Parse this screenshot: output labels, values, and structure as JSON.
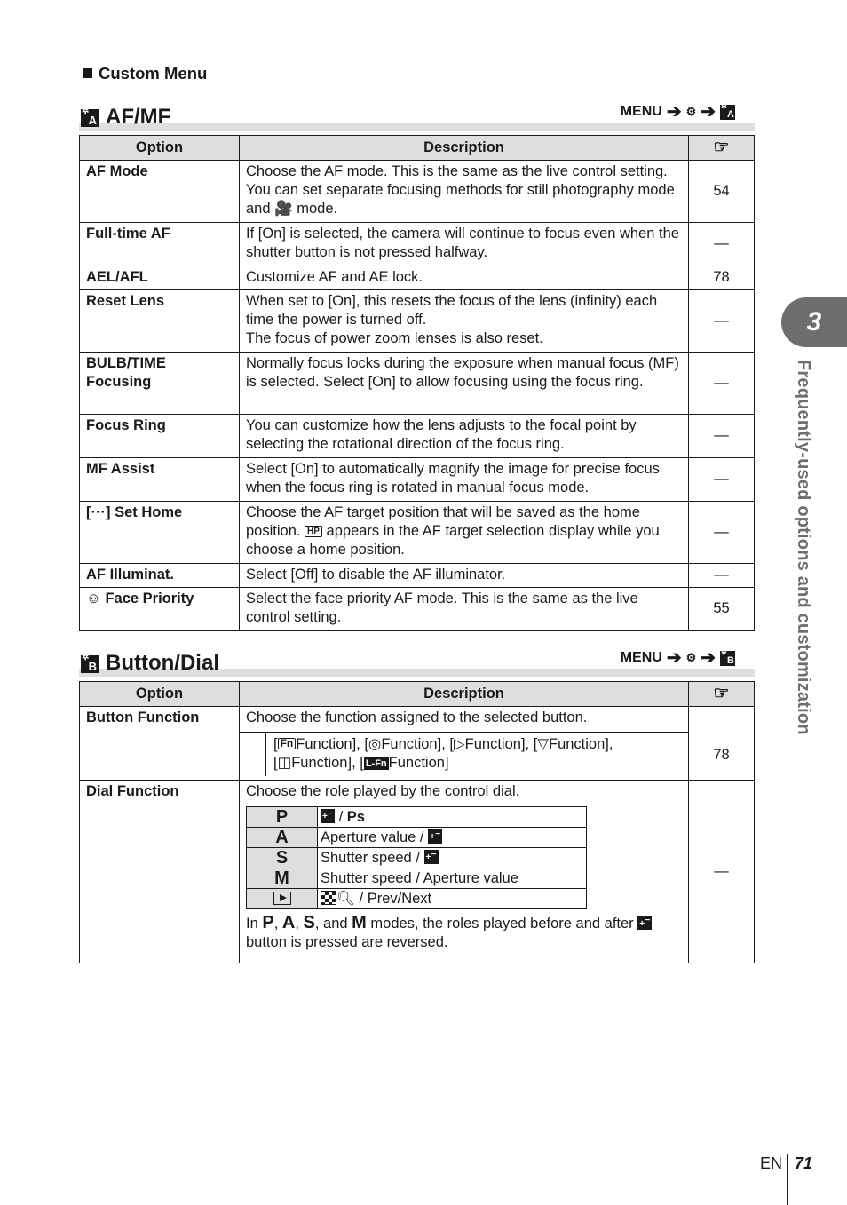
{
  "page": {
    "heading": "Custom Menu",
    "side_tab": {
      "chapter": "3",
      "label": "Frequently-used options and customization"
    },
    "footer": {
      "lang": "EN",
      "page_number": "71"
    }
  },
  "table_headers": {
    "option": "Option",
    "description": "Description",
    "ref_icon": "page-reference-hand-icon"
  },
  "afmf": {
    "title": "AF/MF",
    "icon_letter": "A",
    "menu_path": {
      "menu": "MENU",
      "icon1": "custom-menu-gear-icon",
      "icon2": "custom-menu-A-icon"
    },
    "rows": [
      {
        "option": "AF Mode",
        "desc_a": "Choose the AF mode. This is the same as the live control setting. You can set separate focusing methods for still photography mode and ",
        "desc_icon": "movie-camera-icon",
        "desc_b": " mode.",
        "ref": "54"
      },
      {
        "option": "Full-time AF",
        "desc": "If [On] is selected, the camera will continue to focus even when the shutter button is not pressed halfway.",
        "ref": "—"
      },
      {
        "option": "AEL/AFL",
        "desc": "Customize AF and AE lock.",
        "ref": "78"
      },
      {
        "option": "Reset Lens",
        "desc": "When set to [On], this resets the focus of the lens (infinity) each time the power is turned off.",
        "desc2": "The focus of power zoom lenses is also reset.",
        "ref": "—"
      },
      {
        "option": "BULB/TIME Focusing",
        "desc": "Normally focus locks during the exposure when manual focus (MF) is selected. Select [On] to allow focusing using the focus ring.",
        "ref": "—"
      },
      {
        "option": "Focus Ring",
        "desc": "You can customize how the lens adjusts to the focal point by selecting the rotational direction of the focus ring.",
        "ref": "—"
      },
      {
        "option": "MF Assist",
        "desc": "Select [On] to automatically magnify the image for precise focus when the focus ring is rotated in manual focus mode.",
        "ref": "—"
      },
      {
        "option_icon": "[···]",
        "option": "Set Home",
        "desc_a": "Choose the AF target position that will be saved as the home position. ",
        "desc_icon": "HP",
        "desc_b": " appears in the AF target selection display while you choose a home position.",
        "ref": "—"
      },
      {
        "option": "AF Illuminat.",
        "desc": "Select [Off] to disable the AF illuminator.",
        "ref": "—"
      },
      {
        "option_icon": "☺",
        "option": "Face Priority",
        "desc": "Select the face priority AF mode. This is the same as the live control setting.",
        "ref": "55"
      }
    ]
  },
  "buttondial": {
    "title": "Button/Dial",
    "icon_letter": "B",
    "menu_path": {
      "menu": "MENU",
      "icon1": "custom-menu-gear-icon",
      "icon2": "custom-menu-B-icon"
    },
    "button_function": {
      "option": "Button Function",
      "desc": "Choose the function assigned to the selected button.",
      "functions": [
        {
          "icon": "Fn",
          "label": "Function"
        },
        {
          "icon": "◎",
          "label": "Function"
        },
        {
          "icon": "▷",
          "label": "Function"
        },
        {
          "icon": "▽",
          "label": "Function"
        },
        {
          "icon": "◫",
          "label": "Function"
        },
        {
          "icon": "L-Fn",
          "label": "Function"
        }
      ],
      "ref": "78"
    },
    "dial_function": {
      "option": "Dial Function",
      "desc": "Choose the role played by the control dial.",
      "modes": [
        {
          "mode": "P",
          "role_icon": "exposure-compensation-icon",
          "role": " / ",
          "role_bold": "Ps"
        },
        {
          "mode": "A",
          "role": "Aperture value  / ",
          "role_icon_after": "exposure-compensation-icon"
        },
        {
          "mode": "S",
          "role": "Shutter speed  / ",
          "role_icon_after": "exposure-compensation-icon"
        },
        {
          "mode": "M",
          "role": "Shutter speed  / Aperture value"
        },
        {
          "mode_icon": "playback-icon",
          "role_icon": "index-magnify-icon",
          "role": "  / Prev/Next"
        }
      ],
      "note_prefix": "In ",
      "note_modes": [
        "P",
        "A",
        "S",
        "M"
      ],
      "note_sep1": ", ",
      "note_and": ", and ",
      "note_a": " modes, the roles played before and after ",
      "note_b": " button is pressed are reversed.",
      "ref": "—"
    }
  }
}
